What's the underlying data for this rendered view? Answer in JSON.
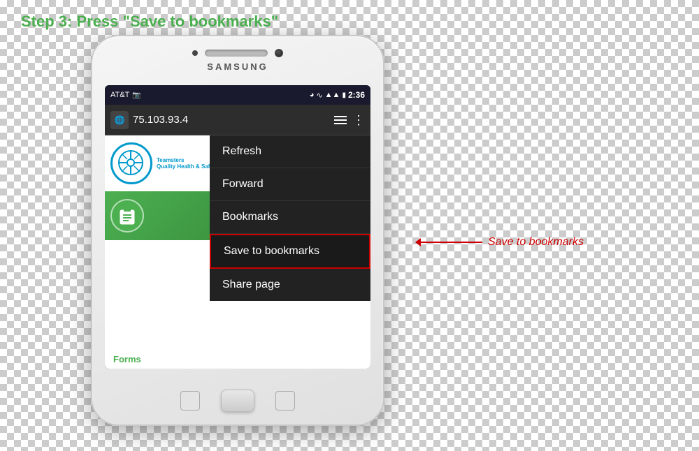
{
  "page": {
    "step_label": "Step 3: Press \"Save to bookmarks\"",
    "background": "checker"
  },
  "phone": {
    "brand": "SAMSUNG",
    "status_bar": {
      "carrier": "AT&T",
      "time": "2:36",
      "icons": [
        "bluetooth",
        "wifi",
        "signal",
        "battery"
      ]
    },
    "address_bar": {
      "url": "75.103.93.4",
      "icon": "🌐"
    },
    "menu": {
      "items": [
        {
          "label": "Refresh",
          "highlighted": false
        },
        {
          "label": "Forward",
          "highlighted": false
        },
        {
          "label": "Bookmarks",
          "highlighted": false
        },
        {
          "label": "Save to bookmarks",
          "highlighted": true
        },
        {
          "label": "Share page",
          "highlighted": false
        }
      ]
    },
    "web": {
      "forms_label": "Forms"
    }
  },
  "annotation": {
    "text": "Save to bookmarks"
  }
}
